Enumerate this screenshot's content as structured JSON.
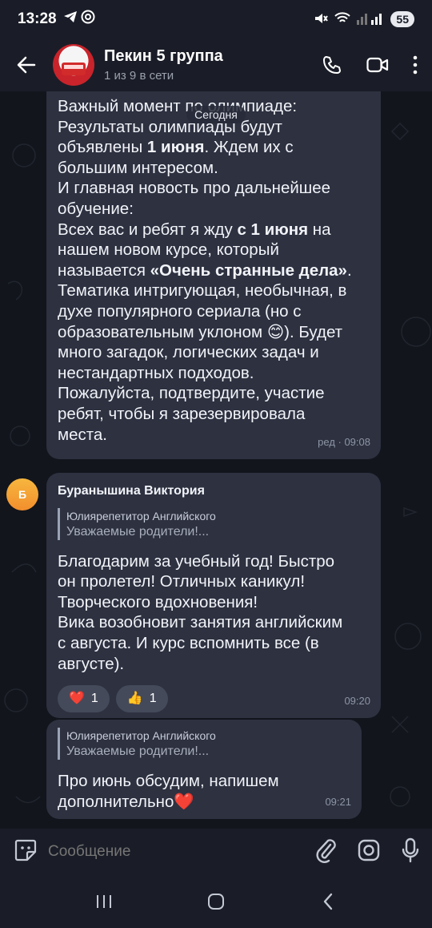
{
  "status": {
    "time": "13:28",
    "battery": "55"
  },
  "header": {
    "title": "Пекин 5 группа",
    "subtitle": "1 из 9 в сети",
    "avatar_icon": "school-bus-logo"
  },
  "date_chip": "Сегодня",
  "messages": [
    {
      "lines": [
        "Важный момент по олимпиаде:",
        "Результаты олимпиады будут",
        "объявлены <b>1 июня</b>. Ждем их с",
        "большим интересом.",
        "И главная новость про дальнейшее",
        "обучение:",
        "Всех вас и ребят я жду <b>с 1 июня</b> на",
        "нашем новом курсе, который",
        "называется <b>«Очень странные дела»</b>.",
        "Тематика интригующая, необычная, в",
        "духе популярного сериала (но с",
        "образовательным уклоном 😊). Будет",
        "много загадок, логических задач и",
        "нестандартных подходов.",
        "Пожалуйста, подтвердите, участие",
        "ребят, чтобы я зарезервировала",
        "места."
      ],
      "meta": "ред · 09:08"
    },
    {
      "avatar_letter": "Б",
      "sender": "Буранышина Виктория",
      "reply_author": "Юлиярепетитор Английского",
      "reply_text": "Уважаемые родители!...",
      "text_lines": [
        "Благодарим за учебный год! Быстро",
        "он пролетел! Отличных каникул!",
        "Творческого вдохновения!",
        "Вика возобновит занятия английским",
        "с августа. И курс вспомнить все (в",
        "августе)."
      ],
      "reactions": [
        {
          "emoji": "❤️",
          "count": "1"
        },
        {
          "emoji": "👍",
          "count": "1"
        }
      ],
      "meta": "09:20"
    },
    {
      "reply_author": "Юлиярепетитор Английского",
      "reply_text": "Уважаемые родители!...",
      "text_lines": [
        "Про июнь обсудим, напишем",
        "дополнительно❤️"
      ],
      "meta": "09:21"
    }
  ],
  "composer": {
    "placeholder": "Сообщение"
  },
  "colors": {
    "bubble": "#2d3140",
    "background": "#12151c",
    "bar": "#1a1d27"
  }
}
